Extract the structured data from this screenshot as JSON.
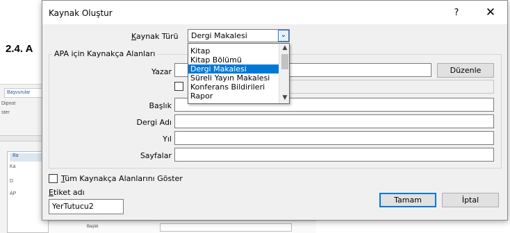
{
  "background": {
    "heading_left": "2.4. A",
    "heading_right": ".",
    "ribbon_tab": "Başvurular",
    "ribbon_item_1": "Dipnot",
    "ribbon_item_2": "ster",
    "inner_tab": "Ba",
    "inner_label": "Ka",
    "inner_short_1": "D",
    "inner_short_2": "AP",
    "bottom_label": "Başlık"
  },
  "dialog": {
    "title": "Kaynak Oluştur",
    "help_label": "?",
    "close_label": "✕",
    "source_type_label": "Kaynak Türü",
    "source_type_value": "Dergi Makalesi",
    "dropdown_options": [
      "Kitap",
      "Kitap Bölümü",
      "Dergi Makalesi",
      "Süreli Yayın Makalesi",
      "Konferans Bildirileri",
      "Rapor"
    ],
    "dropdown_selected_index": 2,
    "group_title": "APA için Kaynakça Alanları",
    "fields": {
      "author_label": "Yazar",
      "title_label": "Başlık",
      "journal_label": "Dergi Adı",
      "year_label": "Yıl",
      "pages_label": "Sayfalar"
    },
    "edit_button": "Düzenle",
    "show_all_label": "Tüm Kaynakça Alanlarını Göster",
    "tag_label": "Etiket adı",
    "tag_value": "YerTutucu2",
    "ok_button": "Tamam",
    "cancel_button": "İptal"
  }
}
